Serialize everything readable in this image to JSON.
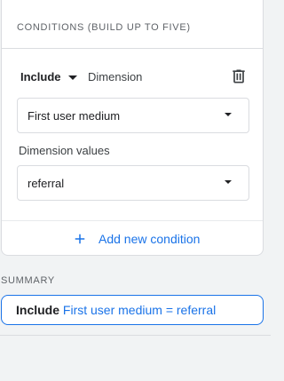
{
  "conditions": {
    "title": "CONDITIONS (BUILD UP TO FIVE)",
    "include_label": "Include",
    "dimension_label": "Dimension",
    "dimension_select": "First user medium",
    "dimension_values_label": "Dimension values",
    "dimension_values_select": "referral",
    "add_condition": "Add new condition"
  },
  "summary": {
    "label": "SUMMARY",
    "include": "Include",
    "expression": "First user medium = referral"
  },
  "colors": {
    "accent": "#1a73e8",
    "border": "#dadce0",
    "background": "#f1f3f4"
  },
  "icons": {
    "include_caret": "caret-down-icon",
    "delete": "trash-icon",
    "select_caret": "caret-down-icon",
    "add": "plus-icon"
  }
}
